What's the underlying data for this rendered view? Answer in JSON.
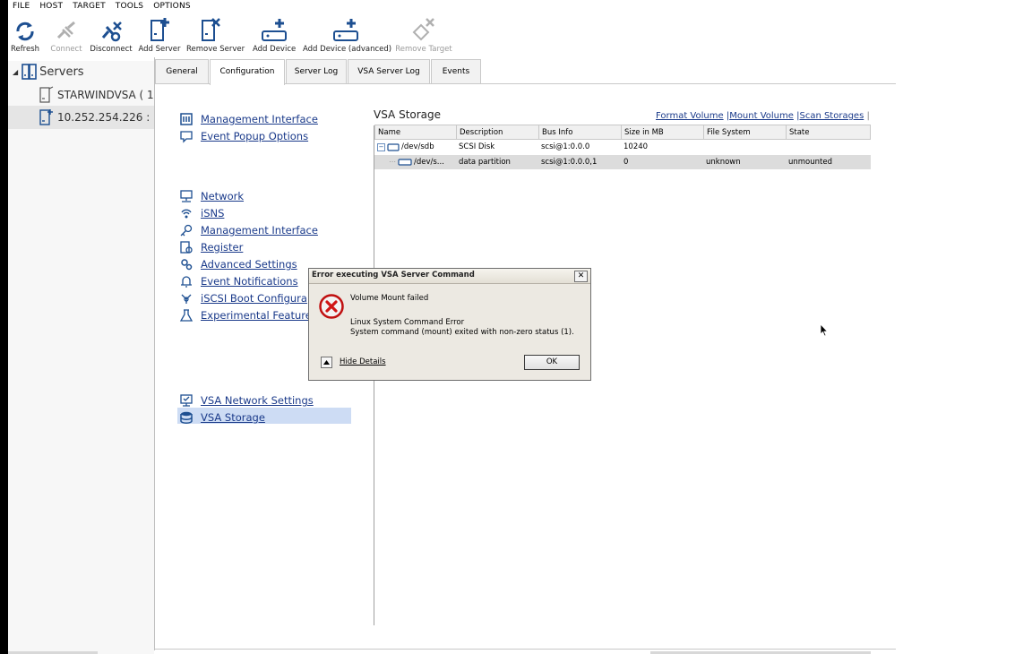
{
  "menu": [
    "FILE",
    "HOST",
    "TARGET",
    "TOOLS",
    "OPTIONS"
  ],
  "toolbar": [
    {
      "label": "Refresh",
      "icon": "refresh-icon",
      "enabled": true
    },
    {
      "label": "Connect",
      "icon": "connect-icon",
      "enabled": false
    },
    {
      "label": "Disconnect",
      "icon": "disconnect-icon",
      "enabled": true
    },
    {
      "label": "Add Server",
      "icon": "add-server-icon",
      "enabled": true
    },
    {
      "label": "Remove Server",
      "icon": "remove-server-icon",
      "enabled": true
    },
    {
      "label": "Add Device",
      "icon": "add-device-icon",
      "enabled": true
    },
    {
      "label": "Add Device (advanced)",
      "icon": "add-device-advanced-icon",
      "enabled": true
    },
    {
      "label": "Remove Target",
      "icon": "remove-target-icon",
      "enabled": false
    }
  ],
  "tree": {
    "root": "Servers",
    "nodes": [
      "STARWINDVSA ( 1",
      "10.252.254.226 :"
    ]
  },
  "tabs": [
    "General",
    "Configuration",
    "Server Log",
    "VSA Server Log",
    "Events"
  ],
  "config_links": {
    "group1": [
      "Management Interface",
      "Event Popup Options"
    ],
    "group2": [
      "Network",
      "iSNS",
      "Management Interface",
      "Register",
      "Advanced Settings",
      "Event Notifications",
      "iSCSI Boot Configura",
      "Experimental Features"
    ],
    "group3": [
      "VSA Network Settings",
      "VSA Storage"
    ]
  },
  "vsa": {
    "title": "VSA Storage",
    "actions": [
      "Format Volume",
      "Mount Volume",
      "Scan Storages"
    ],
    "columns": [
      "Name",
      "Description",
      "Bus Info",
      "Size in MB",
      "File System",
      "State"
    ],
    "rows": [
      {
        "name": "/dev/sdb",
        "description": "SCSI Disk",
        "bus": "scsi@1:0.0.0",
        "size": "10240",
        "fs": "",
        "state": ""
      },
      {
        "name": "/dev/s...",
        "description": "data partition",
        "bus": "scsi@1:0.0.0,1",
        "size": "0",
        "fs": "unknown",
        "state": "unmounted"
      }
    ]
  },
  "dialog": {
    "title": "Error executing VSA Server Command",
    "message": "Volume Mount failed",
    "detail_line1": "Linux System Command Error",
    "detail_line2": "System command (mount) exited with non-zero status (1).",
    "toggle_label": "Hide Details",
    "ok_label": "OK",
    "close_glyph": "✕"
  }
}
